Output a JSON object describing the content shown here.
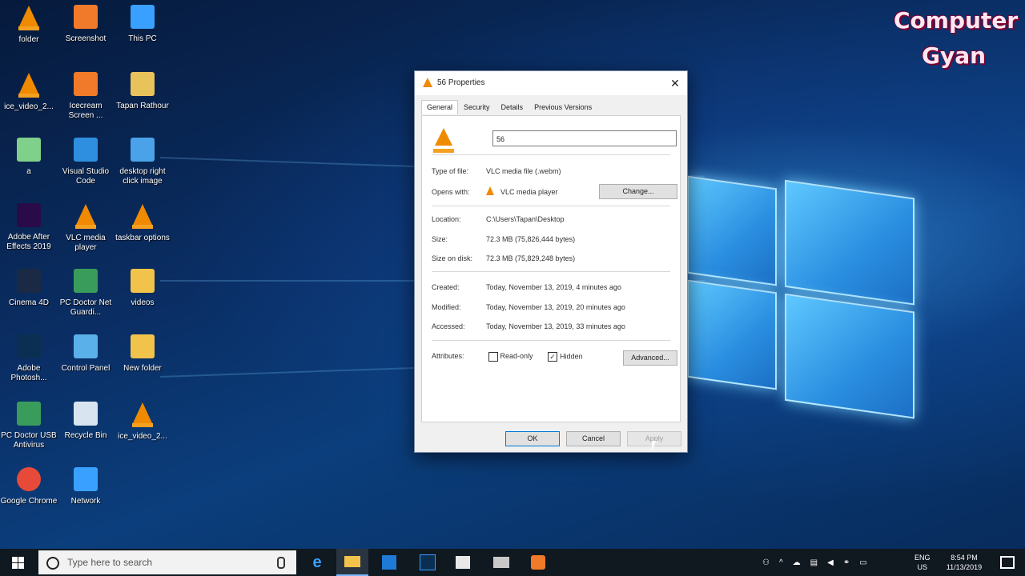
{
  "watermark": {
    "line1": "Computer",
    "line2": "Gyan"
  },
  "desktop_icons": [
    {
      "label": "folder",
      "icon": "vlc-cone-icon"
    },
    {
      "label": "Screenshot",
      "icon": "icecream-screen-recorder-icon"
    },
    {
      "label": "This PC",
      "icon": "this-pc-icon"
    },
    {
      "label": "ice_video_2...",
      "icon": "vlc-cone-icon"
    },
    {
      "label": "Icecream Screen ...",
      "icon": "icecream-screen-recorder-icon"
    },
    {
      "label": "Tapan Rathour",
      "icon": "user-folder-icon"
    },
    {
      "label": "a",
      "icon": "generic-file-icon"
    },
    {
      "label": "Visual Studio Code",
      "icon": "vscode-icon"
    },
    {
      "label": "desktop right click image",
      "icon": "image-file-icon"
    },
    {
      "label": "Adobe After Effects 2019",
      "icon": "after-effects-icon"
    },
    {
      "label": "VLC media player",
      "icon": "vlc-cone-icon"
    },
    {
      "label": "taskbar options",
      "icon": "vlc-cone-icon"
    },
    {
      "label": "Cinema 4D",
      "icon": "cinema4d-icon"
    },
    {
      "label": "PC Doctor Net Guardi...",
      "icon": "pc-doctor-icon"
    },
    {
      "label": "videos",
      "icon": "folder-icon"
    },
    {
      "label": "Adobe Photosh...",
      "icon": "photoshop-icon"
    },
    {
      "label": "Control Panel",
      "icon": "control-panel-icon"
    },
    {
      "label": "New folder",
      "icon": "folder-icon"
    },
    {
      "label": "PC Doctor USB Antivirus",
      "icon": "pc-doctor-icon"
    },
    {
      "label": "Recycle Bin",
      "icon": "recycle-bin-icon"
    },
    {
      "label": "ice_video_2...",
      "icon": "vlc-cone-icon"
    },
    {
      "label": "Google Chrome",
      "icon": "chrome-icon"
    },
    {
      "label": "Network",
      "icon": "network-icon"
    }
  ],
  "dialog": {
    "title": "56 Properties",
    "close": "✕",
    "tabs": [
      "General",
      "Security",
      "Details",
      "Previous Versions"
    ],
    "name_value": "56",
    "type_label": "Type of file:",
    "type_value": "VLC media file (.webm)",
    "opens_label": "Opens with:",
    "opens_value": "VLC media player",
    "change_button": "Change...",
    "location_label": "Location:",
    "location_value": "C:\\Users\\Tapan\\Desktop",
    "size_label": "Size:",
    "size_value": "72.3 MB (75,826,444 bytes)",
    "size_disk_label": "Size on disk:",
    "size_disk_value": "72.3 MB (75,829,248 bytes)",
    "created_label": "Created:",
    "created_value": "Today, November 13, 2019, 4 minutes ago",
    "modified_label": "Modified:",
    "modified_value": "Today, November 13, 2019, 20 minutes ago",
    "accessed_label": "Accessed:",
    "accessed_value": "Today, November 13, 2019, 33 minutes ago",
    "attributes_label": "Attributes:",
    "readonly_label": "Read-only",
    "readonly_checked": false,
    "hidden_label": "Hidden",
    "hidden_checked": true,
    "advanced_button": "Advanced...",
    "ok_button": "OK",
    "cancel_button": "Cancel",
    "apply_button": "Apply"
  },
  "taskbar": {
    "search_placeholder": "Type here to search",
    "lang_top": "ENG",
    "lang_bottom": "US",
    "time": "8:54 PM",
    "date": "11/13/2019"
  }
}
